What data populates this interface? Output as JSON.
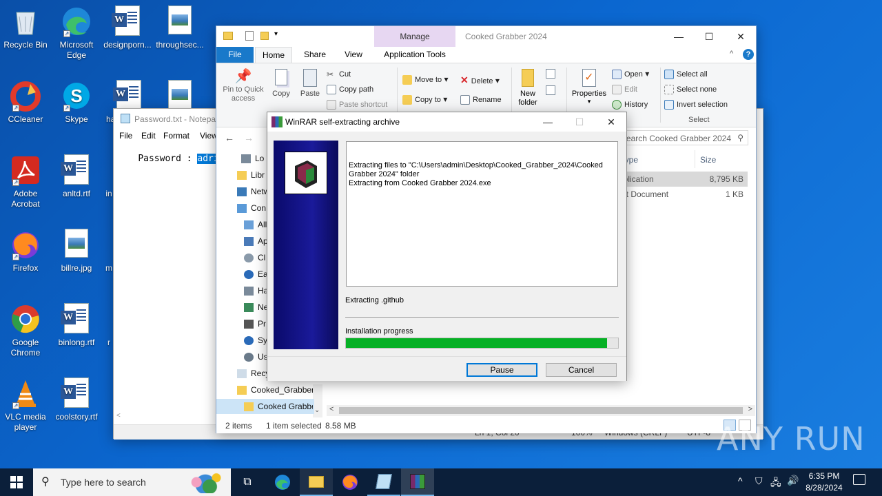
{
  "desktop": {
    "icons": [
      {
        "label": "Recycle Bin"
      },
      {
        "label": "Microsoft Edge"
      },
      {
        "label": "designporn..."
      },
      {
        "label": "throughsec..."
      },
      {
        "label": "CCleaner"
      },
      {
        "label": "Skype"
      },
      {
        "label": "ha"
      },
      {
        "label": "Adobe Acrobat"
      },
      {
        "label": "anltd.rtf"
      },
      {
        "label": "in"
      },
      {
        "label": "Firefox"
      },
      {
        "label": "billre.jpg"
      },
      {
        "label": "m"
      },
      {
        "label": "Google Chrome"
      },
      {
        "label": "binlong.rtf"
      },
      {
        "label": "r"
      },
      {
        "label": "VLC media player"
      },
      {
        "label": "coolstory.rtf"
      }
    ]
  },
  "notepad": {
    "title": "Password.txt - Notepad",
    "menu": [
      "File",
      "Edit",
      "Format",
      "View"
    ],
    "text_prefix": "Password : ",
    "selected_text": "adrikad",
    "status": [
      "Ln 1, Col 20",
      "100%",
      "Windows (CRLF)",
      "UTF-8"
    ]
  },
  "explorer": {
    "title": "Cooked Grabber 2024",
    "context_tab": "Manage",
    "tabs": [
      "File",
      "Home",
      "Share",
      "View",
      "Application Tools"
    ],
    "clipboard": {
      "pin": "Pin to Quick access",
      "copy": "Copy",
      "paste": "Paste",
      "cut": "Cut",
      "copy_path": "Copy path",
      "paste_shortcut": "Paste shortcut"
    },
    "organize": {
      "move_to": "Move to",
      "copy_to": "Copy to",
      "delete": "Delete",
      "rename": "Rename"
    },
    "new": {
      "new_folder": "New folder"
    },
    "open": {
      "properties": "Properties",
      "open": "Open",
      "edit": "Edit",
      "history": "History"
    },
    "select": {
      "select_all": "Select all",
      "select_none": "Select none",
      "invert": "Invert selection",
      "group": "Select"
    },
    "search_placeholder": "Search Cooked Grabber 2024",
    "columns": {
      "type": "Type",
      "size": "Size"
    },
    "files": [
      {
        "type": "Application",
        "size": "8,795 KB"
      },
      {
        "type": "Text Document",
        "size": "1 KB"
      }
    ],
    "nav": [
      "Lo",
      "Libr",
      "Netw",
      "Con",
      "All",
      "Ap",
      "Cl",
      "Ea",
      "Ha",
      "Ne",
      "Pr",
      "Sy",
      "Us",
      "Recy",
      "Cooked_Grabber",
      "Cooked Grabbe"
    ],
    "status_items": "2 items",
    "status_selected": "1 item selected",
    "status_size": "8.58 MB"
  },
  "winrar": {
    "title": "WinRAR self-extracting archive",
    "log": "Extracting files to \"C:\\Users\\admin\\Desktop\\Cooked_Grabber_2024\\Cooked Grabber 2024\" folder\nExtracting from Cooked Grabber 2024.exe",
    "current": "Extracting .github",
    "progress_label": "Installation progress",
    "progress": 0.96,
    "pause": "Pause",
    "cancel": "Cancel"
  },
  "taskbar": {
    "search_placeholder": "Type here to search",
    "time": "6:35 PM",
    "date": "8/28/2024"
  },
  "watermark": "ANY RUN"
}
